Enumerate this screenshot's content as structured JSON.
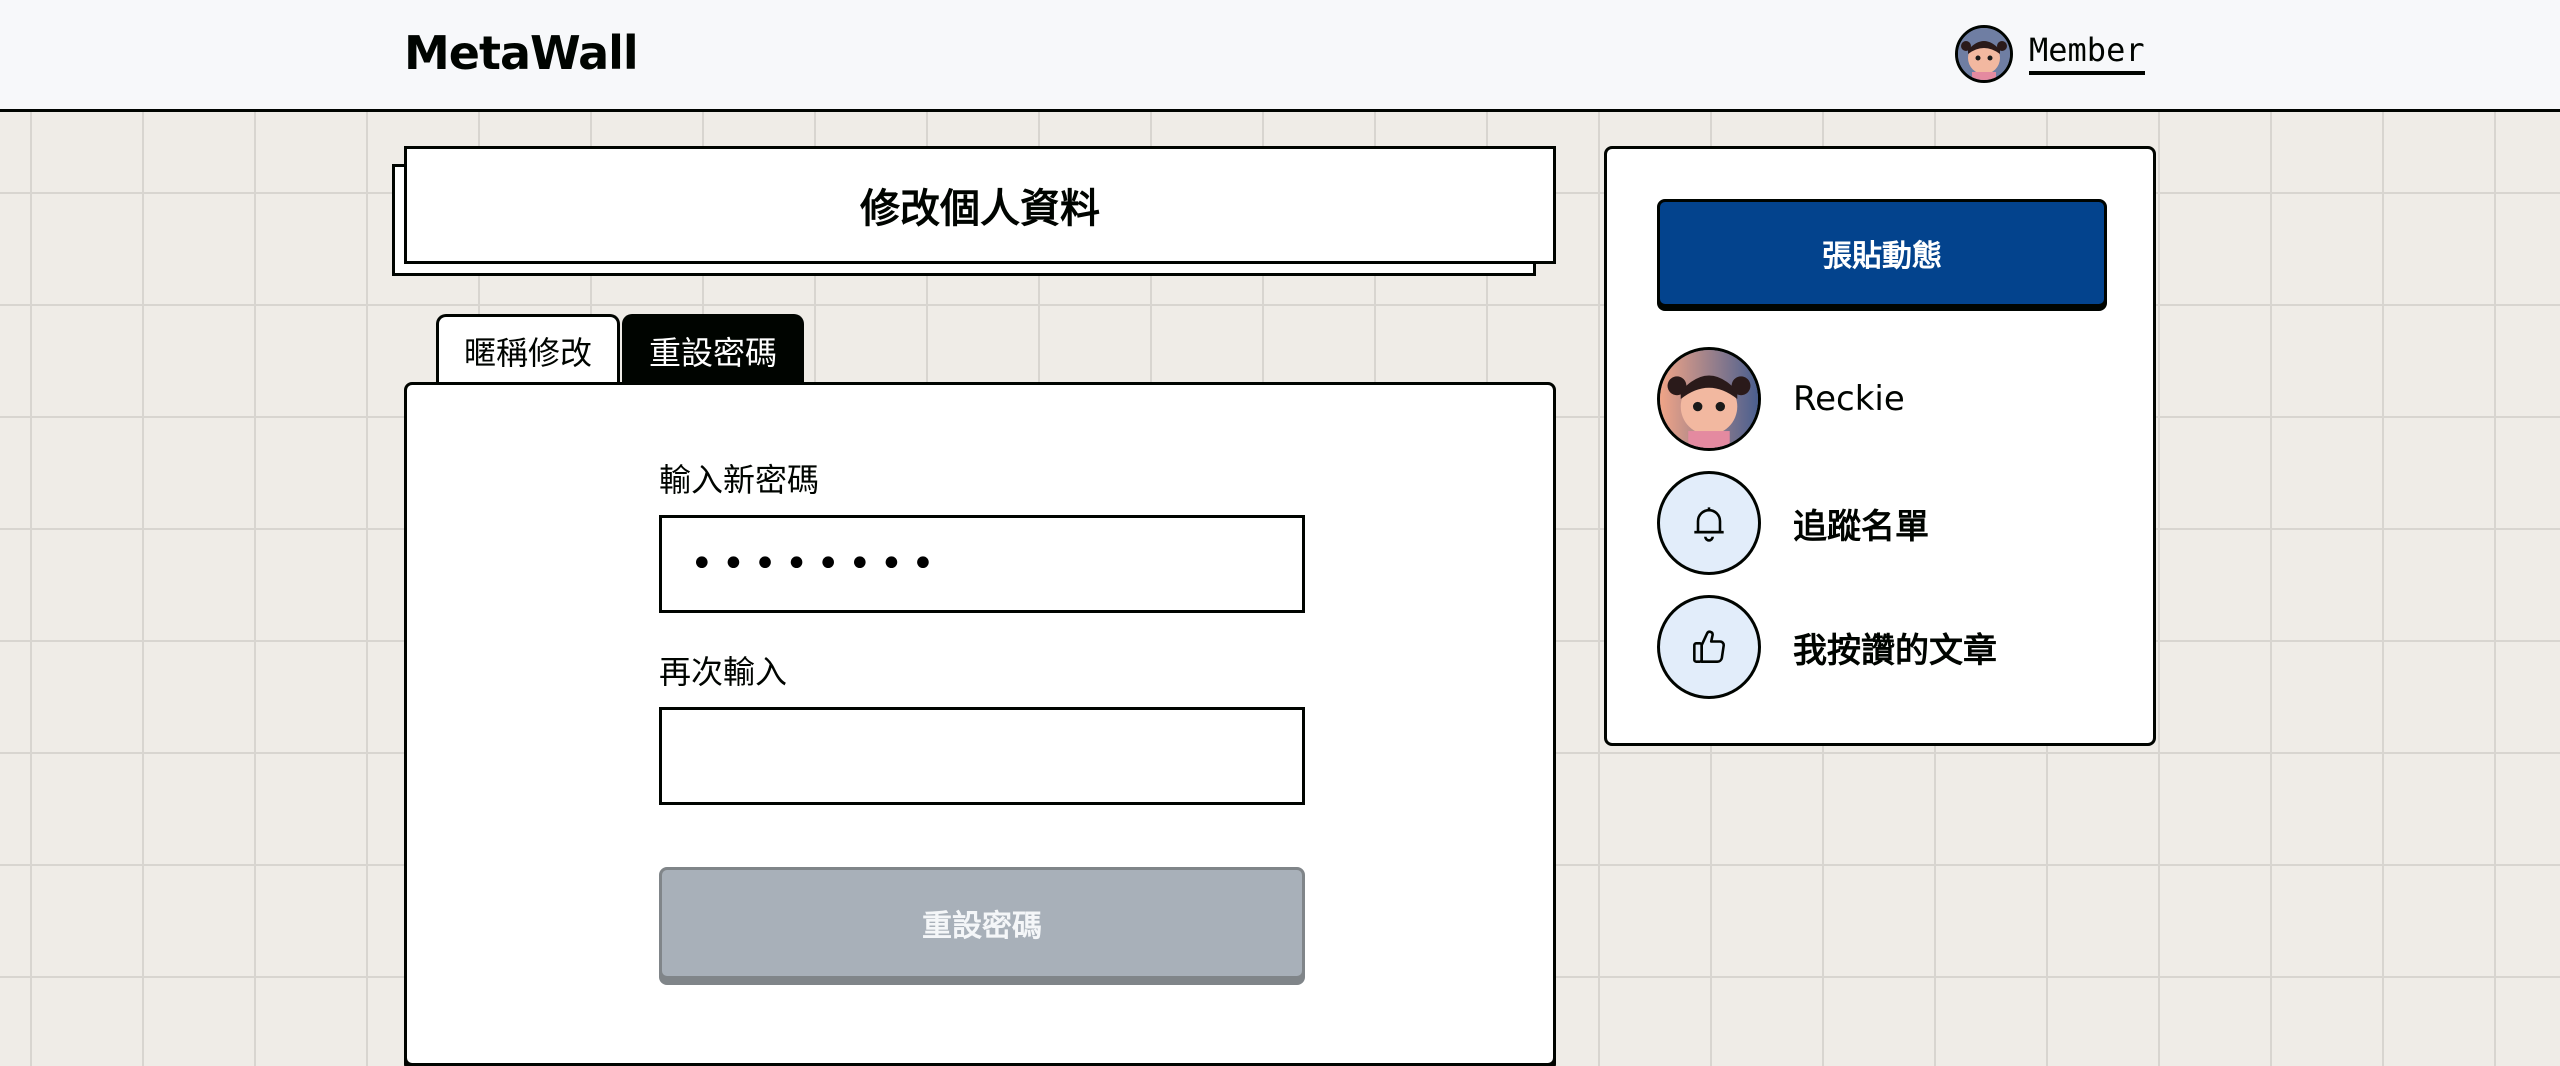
{
  "header": {
    "logo": "MetaWall",
    "member_label": "Member"
  },
  "page": {
    "title": "修改個人資料"
  },
  "tabs": [
    {
      "label": "暱稱修改",
      "active": false
    },
    {
      "label": "重設密碼",
      "active": true
    }
  ],
  "form": {
    "new_password_label": "輸入新密碼",
    "new_password_value": "••••••••",
    "confirm_label": "再次輸入",
    "confirm_value": "",
    "submit_label": "重設密碼"
  },
  "sidebar": {
    "post_button": "張貼動態",
    "user_name": "Reckie",
    "items": [
      {
        "label": "追蹤名單",
        "icon": "bell-icon"
      },
      {
        "label": "我按讚的文章",
        "icon": "thumbs-up-icon"
      }
    ]
  },
  "colors": {
    "brand_blue": "#03438d",
    "border": "#000400",
    "background": "#efece7",
    "disabled_button": "#a8b0b9",
    "icon_circle": "#e2edfa"
  }
}
